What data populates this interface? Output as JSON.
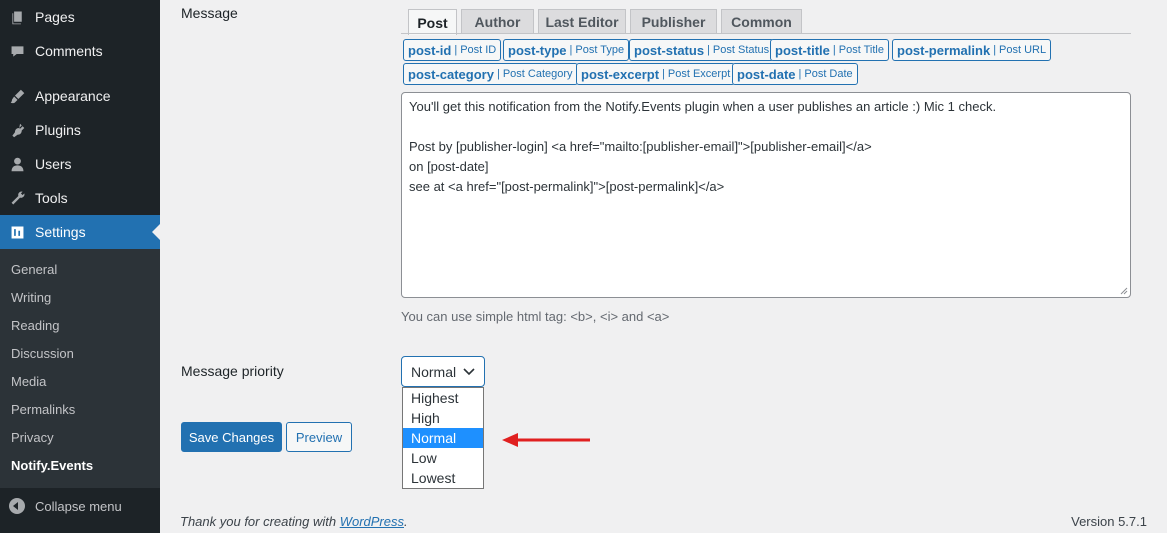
{
  "sidebar": {
    "items": [
      {
        "label": "Pages",
        "icon": "pages-icon"
      },
      {
        "label": "Comments",
        "icon": "comments-icon"
      },
      {
        "label": "Appearance",
        "icon": "appearance-icon"
      },
      {
        "label": "Plugins",
        "icon": "plugins-icon"
      },
      {
        "label": "Users",
        "icon": "users-icon"
      },
      {
        "label": "Tools",
        "icon": "tools-icon"
      },
      {
        "label": "Settings",
        "icon": "settings-icon"
      }
    ],
    "submenu": [
      "General",
      "Writing",
      "Reading",
      "Discussion",
      "Media",
      "Permalinks",
      "Privacy",
      "Notify.Events"
    ],
    "collapse_label": "Collapse menu"
  },
  "message": {
    "label": "Message",
    "tabs": [
      "Post",
      "Author",
      "Last Editor",
      "Publisher",
      "Common"
    ],
    "tags": [
      {
        "key": "post-id",
        "desc": "Post ID"
      },
      {
        "key": "post-type",
        "desc": "Post Type"
      },
      {
        "key": "post-status",
        "desc": "Post Status"
      },
      {
        "key": "post-title",
        "desc": "Post Title"
      },
      {
        "key": "post-permalink",
        "desc": "Post URL"
      },
      {
        "key": "post-category",
        "desc": "Post Category"
      },
      {
        "key": "post-excerpt",
        "desc": "Post Excerpt"
      },
      {
        "key": "post-date",
        "desc": "Post Date"
      }
    ],
    "separator": "|",
    "text_lines": [
      "You'll get this notification from the Notify.Events plugin when a user publishes an article :) Mic 1 check.",
      "",
      "Post by [publisher-login] <a href=\"mailto:[publisher-email]\">[publisher-email]</a>",
      "on [post-date]",
      "see at <a href=\"[post-permalink]\">[post-permalink]</a>"
    ],
    "hint": "You can use simple html tag: <b>, <i> and <a>"
  },
  "priority": {
    "label": "Message priority",
    "selected": "Normal",
    "options": [
      "Highest",
      "High",
      "Normal",
      "Low",
      "Lowest"
    ]
  },
  "buttons": {
    "save": "Save Changes",
    "preview": "Preview"
  },
  "footer": {
    "thanks_prefix": "Thank you for creating with ",
    "thanks_link": "WordPress",
    "thanks_suffix": ".",
    "version": "Version 5.7.1"
  },
  "colors": {
    "accent": "#2271b1",
    "sidebar_bg": "#1d2327",
    "annotation_arrow": "#e02020",
    "dropdown_highlight": "#1e90ff"
  }
}
